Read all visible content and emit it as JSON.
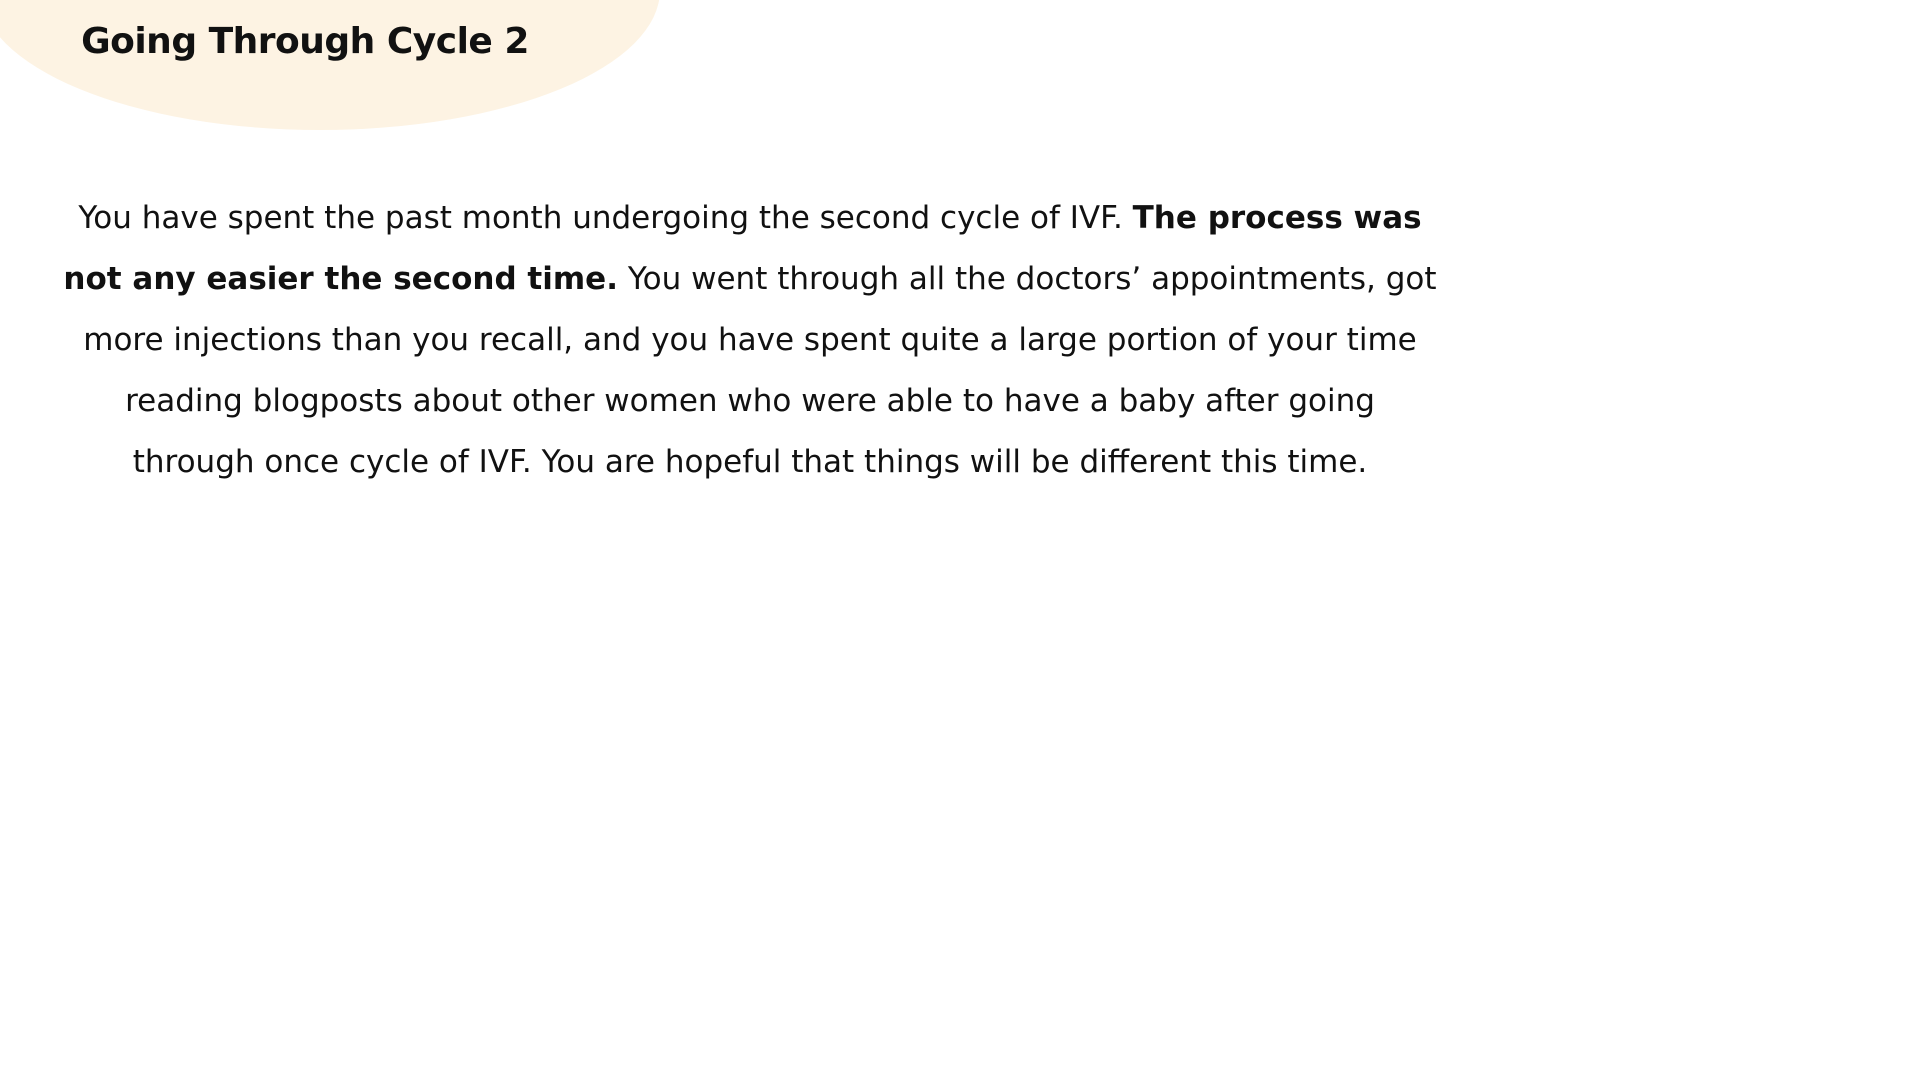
{
  "slide": {
    "title": "Going Through Cycle 2",
    "background_color": "#ffffff",
    "title_blob_color": "#fdf3e3",
    "paragraph": {
      "part1": "You have spent the past month undergoing the second cycle of IVF. ",
      "part2_bold": "The process was not any easier the second time.",
      "part3": " You went through all the doctors’ appointments, got more injections than you recall, and you have spent quite a large portion of your time reading blogposts about other women who were able to have a baby after going through once cycle of IVF. You are hopeful that things will be different this time."
    }
  }
}
